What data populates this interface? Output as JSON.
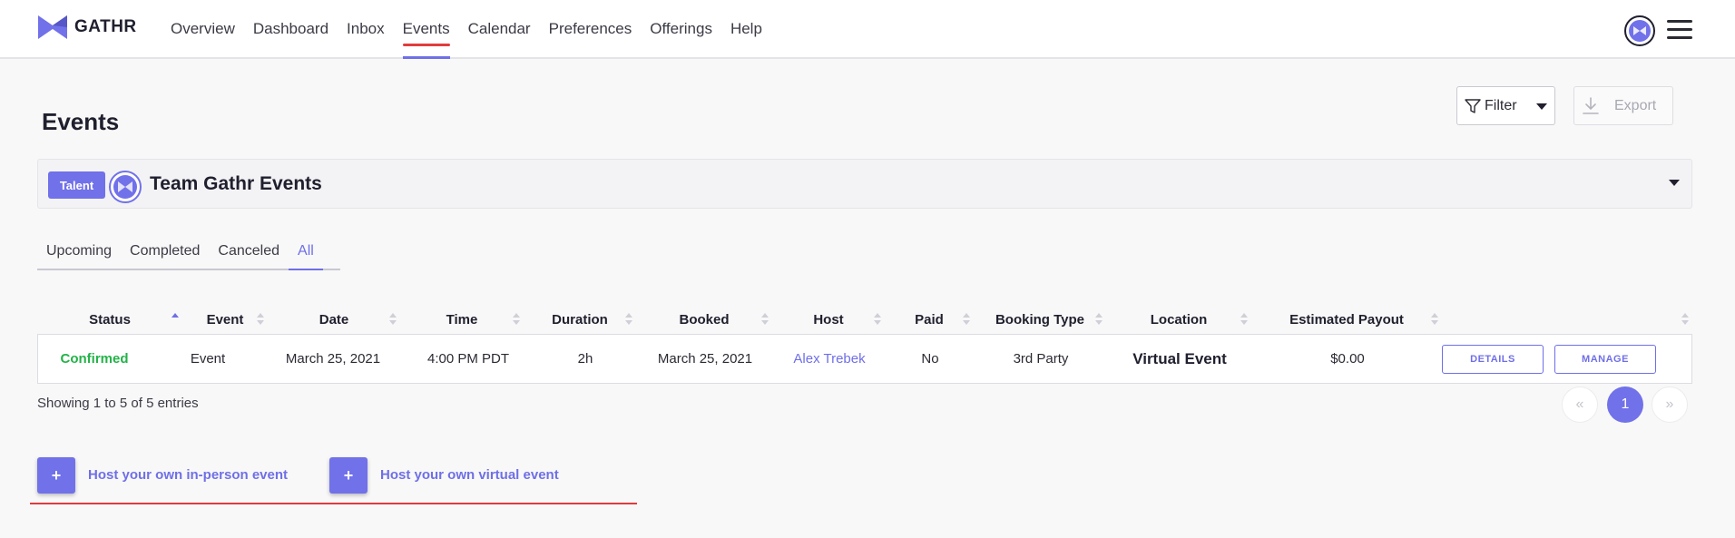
{
  "brand": {
    "name": "GATHR",
    "accent": "#7171ea",
    "success": "#23b348",
    "highlight": "#e23b3b"
  },
  "nav": {
    "items": [
      {
        "label": "Overview",
        "active": false
      },
      {
        "label": "Dashboard",
        "active": false
      },
      {
        "label": "Inbox",
        "active": false
      },
      {
        "label": "Events",
        "active": true
      },
      {
        "label": "Calendar",
        "active": false
      },
      {
        "label": "Preferences",
        "active": false
      },
      {
        "label": "Offerings",
        "active": false
      },
      {
        "label": "Help",
        "active": false
      }
    ],
    "avatar_icon": "gathr-avatar-icon",
    "menu_icon": "hamburger-menu-icon"
  },
  "page": {
    "title": "Events"
  },
  "toolbar": {
    "filter_label": "Filter",
    "export_label": "Export",
    "filter_icon": "funnel-icon",
    "export_icon": "download-icon"
  },
  "talent": {
    "badge": "Talent",
    "name": "Team Gathr Events"
  },
  "tabs": [
    {
      "label": "Upcoming",
      "active": false
    },
    {
      "label": "Completed",
      "active": false
    },
    {
      "label": "Canceled",
      "active": false
    },
    {
      "label": "All",
      "active": true
    }
  ],
  "table": {
    "columns": [
      "Status",
      "Event",
      "Date",
      "Time",
      "Duration",
      "Booked",
      "Host",
      "Paid",
      "Booking Type",
      "Location",
      "Estimated Payout",
      ""
    ],
    "rows": [
      {
        "status": "Confirmed",
        "event": "Event",
        "date": "March 25, 2021",
        "time": "4:00 PM PDT",
        "duration": "2h",
        "booked": "March 25, 2021",
        "host": "Alex Trebek",
        "paid": "No",
        "booking_type": "3rd Party",
        "location": "Virtual Event",
        "payout": "$0.00",
        "details_label": "DETAILS",
        "manage_label": "MANAGE"
      }
    ]
  },
  "pagination": {
    "summary": "Showing 1 to 5 of 5 entries",
    "prev": "«",
    "current": "1",
    "next": "»"
  },
  "host_actions": {
    "in_person_label": "Host your own in-person event",
    "virtual_label": "Host your own virtual event",
    "plus": "+"
  }
}
